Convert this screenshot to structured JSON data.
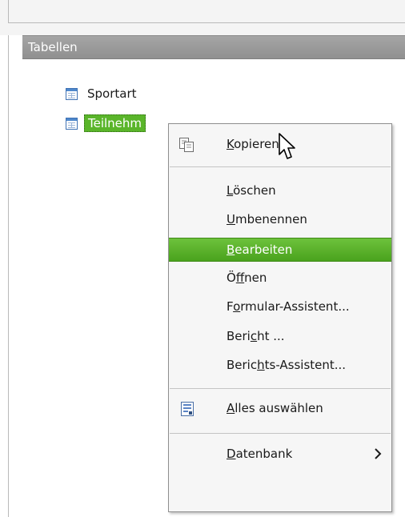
{
  "panel": {
    "title": "Tabellen"
  },
  "tables": [
    {
      "label": "Sportart",
      "selected": false
    },
    {
      "label": "Teilnehm",
      "selected": true
    }
  ],
  "menu": {
    "items": [
      {
        "id": "copy",
        "pre": "",
        "key": "K",
        "post": "opieren",
        "icon": "copy-icon"
      },
      {
        "id": "delete",
        "pre": "",
        "key": "L",
        "post": "öschen"
      },
      {
        "id": "rename",
        "pre": "",
        "key": "U",
        "post": "mbenennen"
      },
      {
        "id": "edit",
        "pre": "",
        "key": "B",
        "post": "earbeiten",
        "highlighted": true
      },
      {
        "id": "open",
        "pre": "Ö",
        "key": "f",
        "post": "fnen"
      },
      {
        "id": "form-wizard",
        "pre": "F",
        "key": "o",
        "post": "rmular-Assistent..."
      },
      {
        "id": "report",
        "pre": "Beri",
        "key": "c",
        "post": "ht ..."
      },
      {
        "id": "report-wizard",
        "pre": "Beric",
        "key": "h",
        "post": "ts-Assistent..."
      },
      {
        "id": "select-all",
        "pre": "",
        "key": "A",
        "post": "lles auswählen",
        "icon": "select-all-icon"
      },
      {
        "id": "database",
        "pre": "",
        "key": "D",
        "post": "atenbank",
        "submenu": true
      }
    ]
  },
  "colors": {
    "highlight": "#5ab52a",
    "header": "#9b9b9b",
    "menu_bg": "#f6f6f6"
  }
}
